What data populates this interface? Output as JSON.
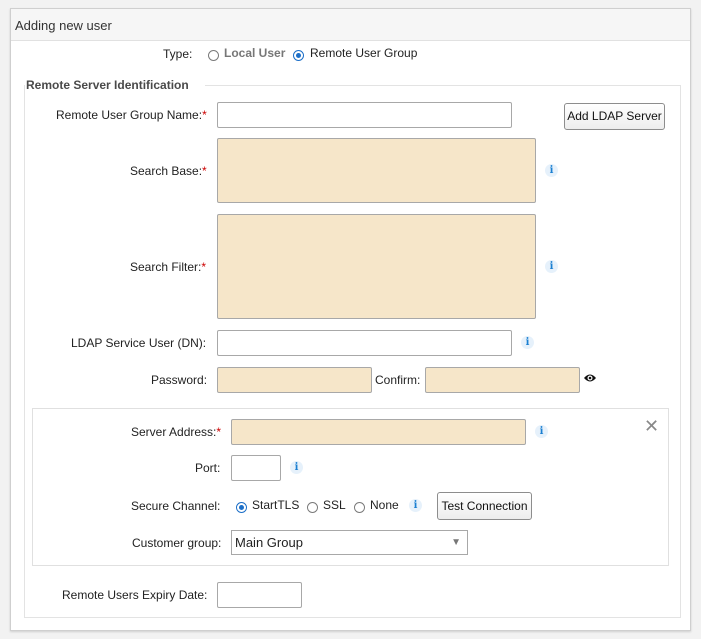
{
  "panel": {
    "title": "Adding new user"
  },
  "type_row": {
    "label": "Type:",
    "options": [
      {
        "label": "Local User",
        "selected": false
      },
      {
        "label": "Remote User Group",
        "selected": true
      }
    ]
  },
  "remote_section": {
    "title": "Remote Server Identification",
    "group_name_label": "Remote User Group Name:",
    "required_mark": "*",
    "add_ldap_button": "Add LDAP Server",
    "search_base_label": "Search Base:",
    "search_filter_label": "Search Filter:",
    "ldap_user_label": "LDAP Service User (DN):",
    "password_label": "Password:",
    "confirm_label": "Confirm:",
    "info_glyph": "i",
    "eye_icon": "eye-icon"
  },
  "server": {
    "address_label": "Server Address:",
    "port_label": "Port:",
    "secure_channel_label": "Secure Channel:",
    "channels": [
      {
        "label": "StartTLS",
        "selected": true
      },
      {
        "label": "SSL",
        "selected": false
      },
      {
        "label": "None",
        "selected": false
      }
    ],
    "test_button": "Test Connection",
    "customer_group_label": "Customer group:",
    "customer_group_value": "Main Group",
    "close_glyph": "✕"
  },
  "expiry": {
    "label": "Remote Users Expiry Date:"
  },
  "colors": {
    "required_bg": "#f6e6c9",
    "accent": "#1c6fc8",
    "info": "#1a7fd1"
  }
}
